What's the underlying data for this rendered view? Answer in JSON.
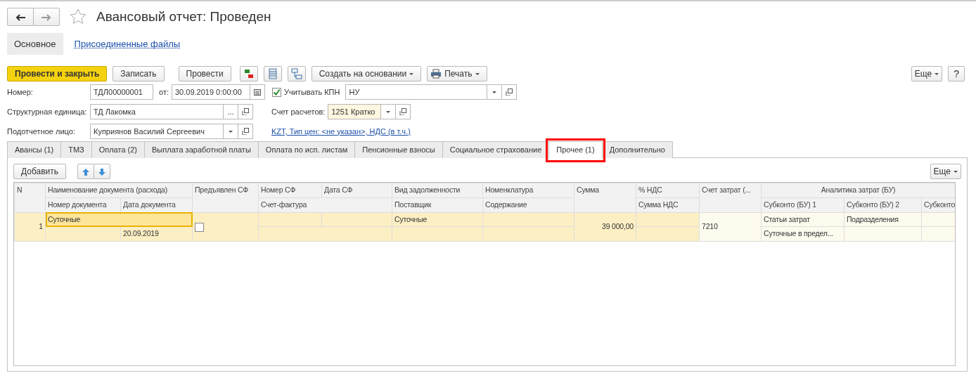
{
  "window": {
    "title": "Авансовый отчет: Проведен",
    "favorite": false
  },
  "sections": [
    {
      "label": "Основное",
      "selected": true
    },
    {
      "label": "Присоединенные файлы",
      "selected": false
    }
  ],
  "toolbar": {
    "post_close": "Провести и закрыть",
    "save": "Записать",
    "post": "Провести",
    "create_based": "Создать на основании",
    "print": "Печать",
    "more": "Еще",
    "help": "?"
  },
  "fields": {
    "number_label": "Номер:",
    "number": "ТДЛ00000001",
    "date_label": "от:",
    "date": "30.09.2019  0:00:00",
    "kpn": {
      "label": "Учитывать КПН",
      "checked": true
    },
    "kpn_value": "НУ",
    "unit_label": "Структурная единица:",
    "unit": "ТД Лакомка",
    "select_button": "...",
    "account_label": "Счет расчетов:",
    "account": "1251 Кратко",
    "person_label": "Подотчетное лицо:",
    "person": "Куприянов Василий Сергеевич",
    "currency_link": "KZT, Тип цен: <не указан>, НДС (в т.ч.)"
  },
  "tabs": [
    {
      "label": "Авансы (1)",
      "selected": false,
      "highlighted": false
    },
    {
      "label": "ТМЗ",
      "selected": false,
      "highlighted": false
    },
    {
      "label": "Оплата (2)",
      "selected": false,
      "highlighted": false
    },
    {
      "label": "Выплата заработной платы",
      "selected": false,
      "highlighted": false
    },
    {
      "label": "Оплата по исп. листам",
      "selected": false,
      "highlighted": false
    },
    {
      "label": "Пенсионные взносы",
      "selected": false,
      "highlighted": false
    },
    {
      "label": "Социальное страхование",
      "selected": false,
      "highlighted": false
    },
    {
      "label": "Прочее (1)",
      "selected": true,
      "highlighted": true
    },
    {
      "label": "Дополнительно",
      "selected": false,
      "highlighted": false
    }
  ],
  "table_toolbar": {
    "add": "Добавить",
    "more": "Еще"
  },
  "table": {
    "header_row_1": [
      "N",
      "Наименование документа (расхода)",
      "Предъявлен СФ",
      "Номер СФ",
      "Дата СФ",
      "Вид задолженности",
      "Номенклатура",
      "Сумма",
      "% НДС",
      "Счет затрат (...",
      "Аналитика затрат (БУ)"
    ],
    "header_row_2": [
      "Номер документа",
      "Дата документа",
      "Счет-фактура",
      "Поставщик",
      "Содержание",
      "Сумма НДС",
      "Субконто (БУ) 1",
      "Субконто (БУ) 2",
      "Субконто"
    ],
    "rows": [
      {
        "selected": true,
        "n": "1",
        "name": "Суточные",
        "invoice_presented": false,
        "debt_type": "Суточные",
        "sum": "39 000,00",
        "account": "7210",
        "subconto_1": "Статьи затрат",
        "subconto_2": "Подразделения",
        "doc_date": "20.09.2019",
        "subconto_1_value": "Суточные в предел..."
      }
    ]
  }
}
